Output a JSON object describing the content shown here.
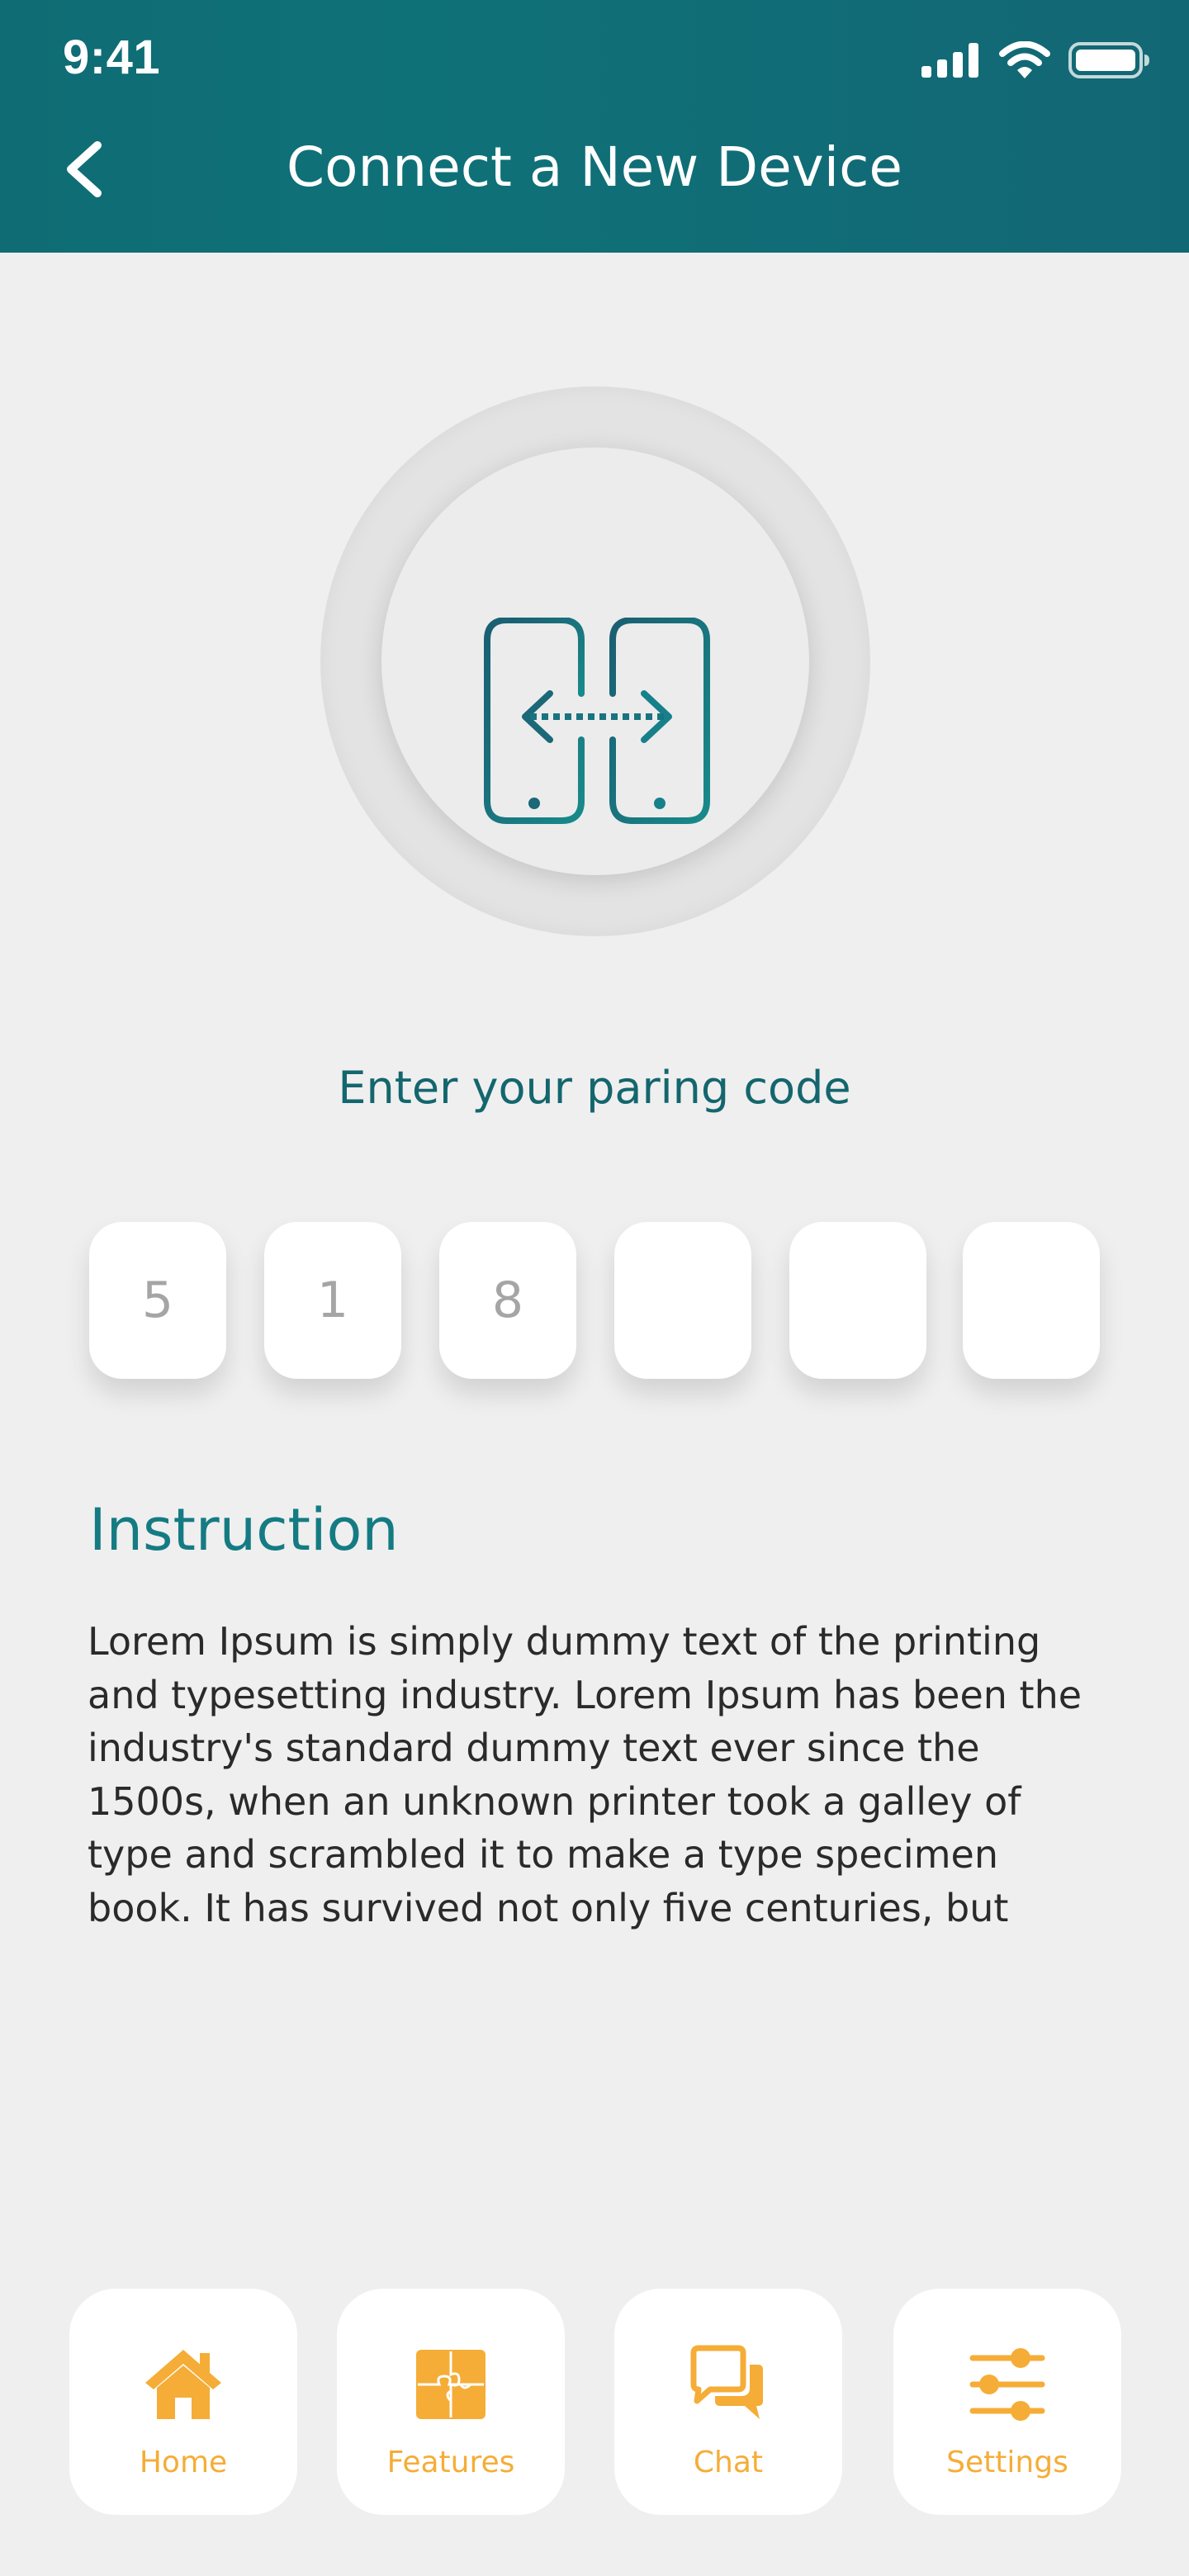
{
  "status_bar": {
    "time": "9:41"
  },
  "header": {
    "title": "Connect a New Device"
  },
  "prompt": "Enter your paring code",
  "code_digits": [
    "5",
    "1",
    "8",
    "",
    "",
    ""
  ],
  "instruction": {
    "title": "Instruction",
    "body": "Lorem Ipsum is simply dummy text of the printing and typesetting industry. Lorem Ipsum has been the industry's standard dummy text ever since the 1500s, when an unknown printer took a galley of type and scrambled it to make a type specimen book. It has survived not only five centuries, but"
  },
  "nav": [
    {
      "label": "Home",
      "icon": "home-icon"
    },
    {
      "label": "Features",
      "icon": "puzzle-icon"
    },
    {
      "label": "Chat",
      "icon": "chat-icon"
    },
    {
      "label": "Settings",
      "icon": "sliders-icon"
    }
  ],
  "colors": {
    "header_teal": "#0f6c74",
    "accent_teal": "#157b83",
    "nav_orange": "#f5ad37",
    "background": "#efefef"
  }
}
